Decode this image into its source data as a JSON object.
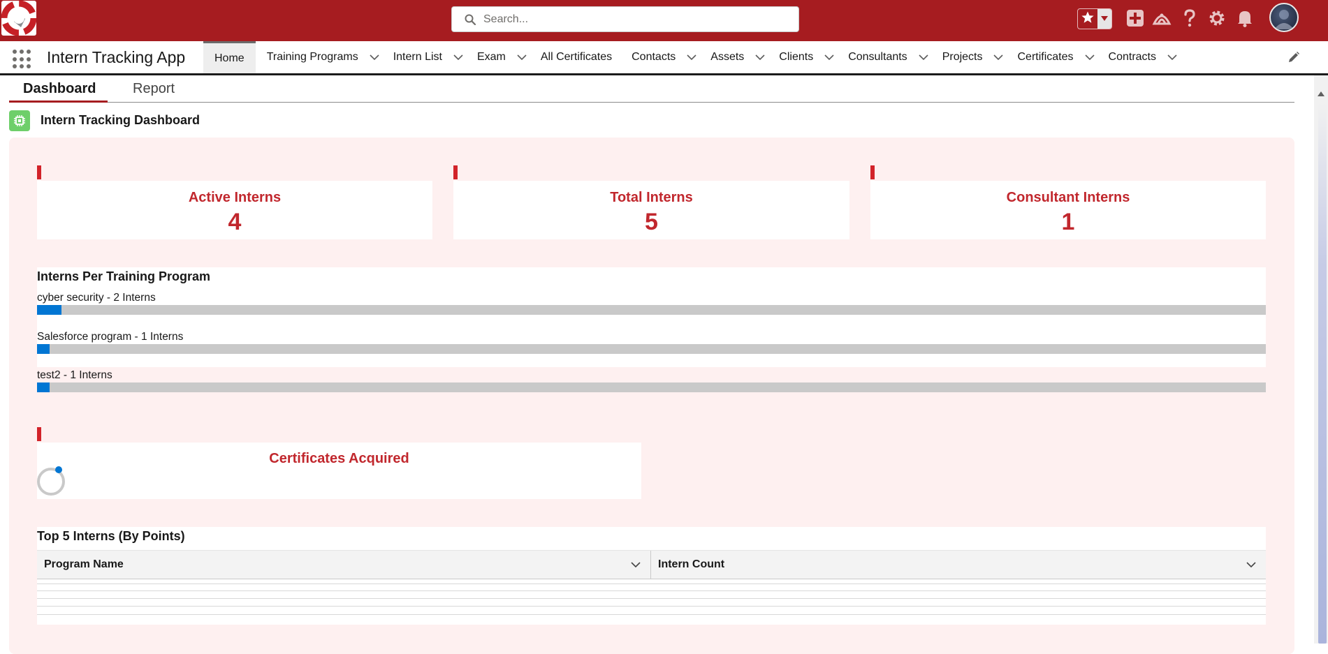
{
  "header": {
    "search_placeholder": "Search...",
    "icons": [
      "star-icon",
      "caret-down-icon",
      "add-icon",
      "trailhead-icon",
      "help-icon",
      "gear-icon",
      "bell-icon"
    ]
  },
  "nav": {
    "app_name": "Intern Tracking App",
    "tabs": [
      {
        "label": "Home",
        "active": true,
        "dropdown": false
      },
      {
        "label": "Training Programs",
        "dropdown": true
      },
      {
        "label": "Intern List",
        "dropdown": true
      },
      {
        "label": "Exam",
        "dropdown": true
      },
      {
        "label": "All Certificates",
        "dropdown": false
      },
      {
        "label": "Contacts",
        "dropdown": true
      },
      {
        "label": "Assets",
        "dropdown": true
      },
      {
        "label": "Clients",
        "dropdown": true
      },
      {
        "label": "Consultants",
        "dropdown": true
      },
      {
        "label": "Projects",
        "dropdown": true
      },
      {
        "label": "Certificates",
        "dropdown": true
      },
      {
        "label": "Contracts",
        "dropdown": true
      }
    ]
  },
  "subtabs": {
    "dashboard": "Dashboard",
    "report": "Report"
  },
  "dashboard": {
    "title": "Intern Tracking Dashboard",
    "colors": {
      "accent": "#c1272d",
      "header": "#a61c20",
      "bar_fill": "#0176d3",
      "bar_track": "#c9c9c9",
      "panel_bg": "#fef0f0"
    },
    "stats": [
      {
        "title": "Active Interns",
        "value": "4"
      },
      {
        "title": "Total Interns",
        "value": "5"
      },
      {
        "title": "Consultant Interns",
        "value": "1"
      }
    ],
    "programs": {
      "title": "Interns Per Training Program",
      "items": [
        {
          "label": "cyber security - 2 Interns",
          "fraction": 0.02
        },
        {
          "label": "Salesforce program - 1 Interns",
          "fraction": 0.01
        },
        {
          "label": "test2 - 1 Interns",
          "fraction": 0.01
        }
      ]
    },
    "certificates": {
      "title": "Certificates Acquired"
    },
    "top_interns": {
      "title": "Top 5 Interns (By Points)",
      "columns": [
        "Program Name",
        "Intern Count"
      ]
    }
  }
}
